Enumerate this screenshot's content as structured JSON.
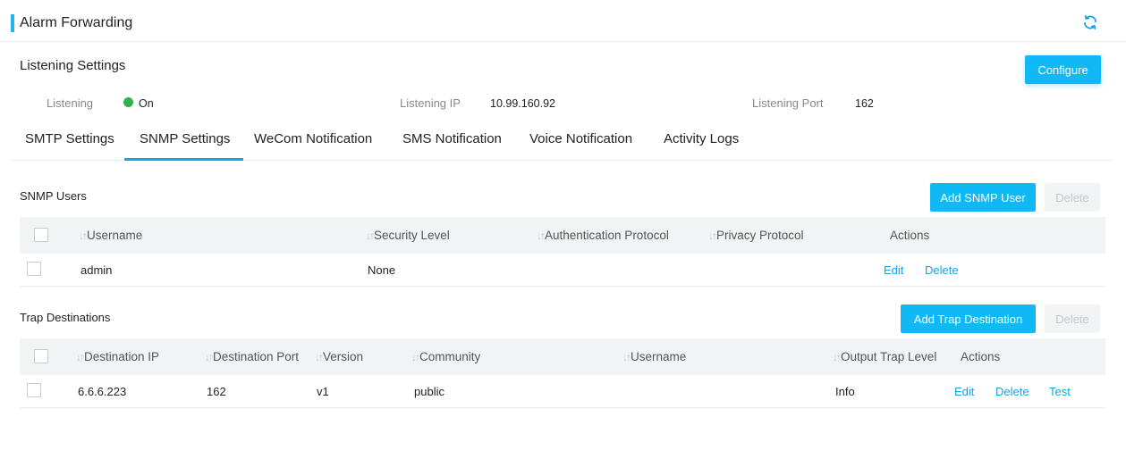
{
  "header": {
    "title": "Alarm Forwarding",
    "refresh_icon": "refresh-icon"
  },
  "listening": {
    "section_title": "Listening Settings",
    "configure_label": "Configure",
    "listening_label": "Listening",
    "listening_value": "On",
    "status_color": "#2db34a",
    "ip_label": "Listening IP",
    "ip_value": "10.99.160.92",
    "port_label": "Listening Port",
    "port_value": "162"
  },
  "tabs": [
    {
      "label": "SMTP Settings"
    },
    {
      "label": "SNMP Settings"
    },
    {
      "label": "WeCom Notification"
    },
    {
      "label": "SMS Notification"
    },
    {
      "label": "Voice Notification"
    },
    {
      "label": "Activity Logs"
    }
  ],
  "active_tab": "SNMP Settings",
  "accent_color": "#10b9f5",
  "snmp_users": {
    "title": "SNMP Users",
    "add_label": "Add SNMP User",
    "delete_label": "Delete",
    "columns": [
      "Username",
      "Security Level",
      "Authentication Protocol",
      "Privacy Protocol",
      "Actions"
    ],
    "rows": [
      {
        "username": "admin",
        "security_level": "None",
        "auth_protocol": "",
        "privacy_protocol": "",
        "actions": [
          "Edit",
          "Delete"
        ]
      }
    ]
  },
  "trap_destinations": {
    "title": "Trap Destinations",
    "add_label": "Add Trap Destination",
    "delete_label": "Delete",
    "columns": [
      "Destination IP",
      "Destination Port",
      "Version",
      "Community",
      "Username",
      "Output Trap Level",
      "Actions"
    ],
    "rows": [
      {
        "ip": "6.6.6.223",
        "port": "162",
        "version": "v1",
        "community": "public",
        "username": "",
        "level": "Info",
        "actions": [
          "Edit",
          "Delete",
          "Test"
        ]
      }
    ]
  }
}
